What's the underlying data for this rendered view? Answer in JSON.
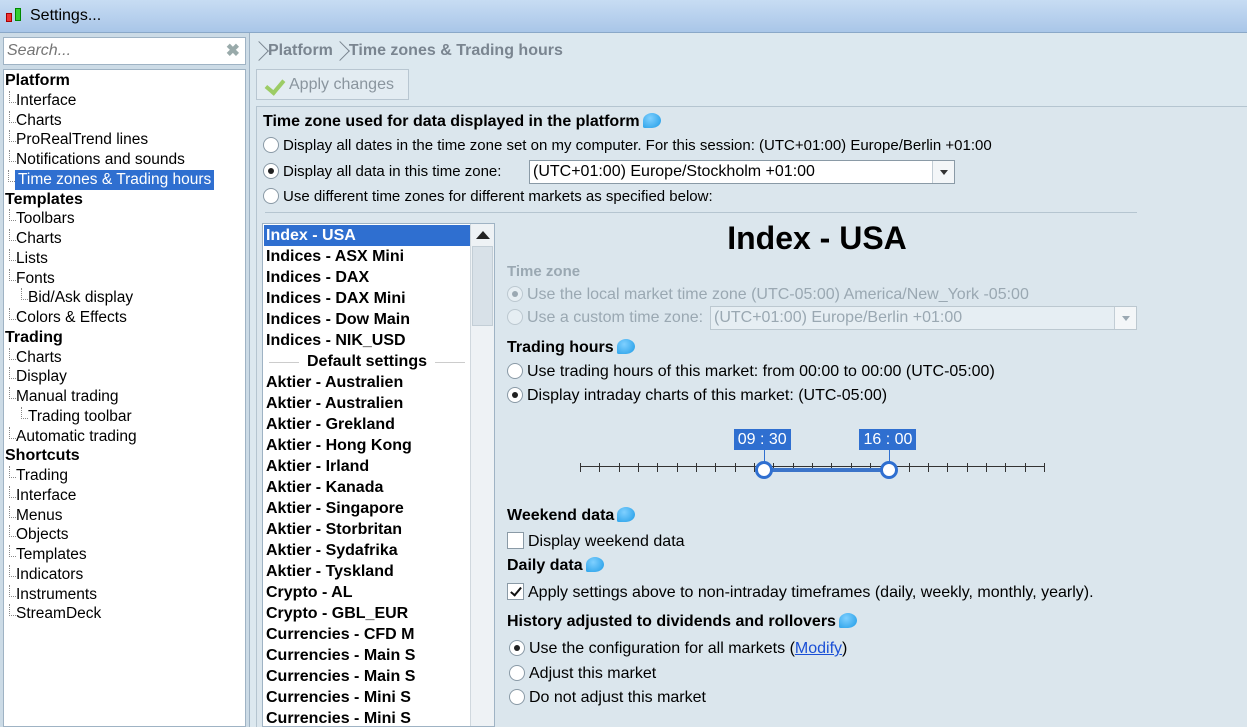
{
  "window": {
    "title": "Settings..."
  },
  "search": {
    "placeholder": "Search...",
    "clear_icon": "close-icon"
  },
  "tree": {
    "items": [
      {
        "label": "Platform",
        "level": 0
      },
      {
        "label": "Interface",
        "level": 1
      },
      {
        "label": "Charts",
        "level": 1
      },
      {
        "label": "ProRealTrend lines",
        "level": 1
      },
      {
        "label": "Notifications and sounds",
        "level": 1
      },
      {
        "label": "Time zones & Trading hours",
        "level": 1,
        "selected": true
      },
      {
        "label": "Templates",
        "level": 0
      },
      {
        "label": "Toolbars",
        "level": 1
      },
      {
        "label": "Charts",
        "level": 1
      },
      {
        "label": "Lists",
        "level": 1
      },
      {
        "label": "Fonts",
        "level": 1
      },
      {
        "label": "Bid/Ask display",
        "level": 2
      },
      {
        "label": "Colors & Effects",
        "level": 1
      },
      {
        "label": "Trading",
        "level": 0
      },
      {
        "label": "Charts",
        "level": 1
      },
      {
        "label": "Display",
        "level": 1
      },
      {
        "label": "Manual trading",
        "level": 1
      },
      {
        "label": "Trading toolbar",
        "level": 2
      },
      {
        "label": "Automatic trading",
        "level": 1
      },
      {
        "label": "Shortcuts",
        "level": 0
      },
      {
        "label": "Trading",
        "level": 1
      },
      {
        "label": "Interface",
        "level": 1
      },
      {
        "label": "Menus",
        "level": 1
      },
      {
        "label": "Objects",
        "level": 1
      },
      {
        "label": "Templates",
        "level": 1
      },
      {
        "label": "Indicators",
        "level": 1
      },
      {
        "label": "Instruments",
        "level": 1
      },
      {
        "label": "StreamDeck",
        "level": 1
      }
    ]
  },
  "breadcrumb": {
    "items": [
      "Platform",
      "Time zones & Trading hours"
    ]
  },
  "toolbar": {
    "apply_label": "Apply changes"
  },
  "timezone_section": {
    "title": "Time zone used for data displayed in the platform",
    "option1": "Display all dates in the time zone set on my computer. For this session:  (UTC+01:00) Europe/Berlin +01:00",
    "option2": "Display all data in this time zone:",
    "option2_value": "(UTC+01:00) Europe/Stockholm +01:00",
    "option3": "Use different time zones for different markets as specified below:",
    "selected": 2
  },
  "markets": {
    "items": [
      {
        "label": "Index - USA",
        "selected": true
      },
      {
        "label": "Indices - ASX Mini"
      },
      {
        "label": "Indices - DAX"
      },
      {
        "label": "Indices - DAX Mini"
      },
      {
        "label": "Indices - Dow Main"
      },
      {
        "label": "Indices - NIK_USD"
      },
      {
        "label": "Default settings",
        "header": true
      },
      {
        "label": "Aktier - Australien"
      },
      {
        "label": "Aktier - Australien"
      },
      {
        "label": "Aktier - Grekland"
      },
      {
        "label": "Aktier - Hong Kong"
      },
      {
        "label": "Aktier - Irland"
      },
      {
        "label": "Aktier - Kanada"
      },
      {
        "label": "Aktier - Singapore"
      },
      {
        "label": "Aktier - Storbritan"
      },
      {
        "label": "Aktier - Sydafrika"
      },
      {
        "label": "Aktier - Tyskland"
      },
      {
        "label": "Crypto - AL"
      },
      {
        "label": "Crypto - GBL_EUR"
      },
      {
        "label": "Currencies - CFD M"
      },
      {
        "label": "Currencies - Main S"
      },
      {
        "label": "Currencies - Main S"
      },
      {
        "label": "Currencies - Mini S"
      },
      {
        "label": "Currencies - Mini S"
      }
    ]
  },
  "detail": {
    "title": "Index - USA",
    "tz_heading": "Time zone",
    "tz_local": "Use the local market time zone (UTC-05:00) America/New_York -05:00",
    "tz_custom": "Use a custom time zone:",
    "tz_custom_value": "(UTC+01:00) Europe/Berlin +01:00",
    "hours_heading": "Trading hours",
    "hours_opt1": "Use trading hours of this market: from 00:00 to 00:00 (UTC-05:00)",
    "hours_opt2": "Display intraday charts of this market: (UTC-05:00)",
    "hours_selected": 2,
    "slider_start": "09 : 30",
    "slider_end": "16 : 00",
    "slider_start_fraction": 0.396,
    "slider_end_fraction": 0.667,
    "slider_ticks": 24,
    "weekend_heading": "Weekend data",
    "weekend_label": "Display weekend data",
    "weekend_checked": false,
    "daily_heading": "Daily data",
    "daily_label": "Apply settings above to non-intraday timeframes (daily, weekly, monthly, yearly).",
    "daily_checked": true,
    "history_heading": "History adjusted to dividends and rollovers",
    "history_opt1": "Use the configuration for all markets",
    "history_opt1_link": "Modify",
    "history_opt2": "Adjust this market",
    "history_opt3": "Do not adjust this market",
    "history_selected": 1
  },
  "colors": {
    "accent": "#2f6fd0",
    "info_icon": "#1e9be6"
  }
}
